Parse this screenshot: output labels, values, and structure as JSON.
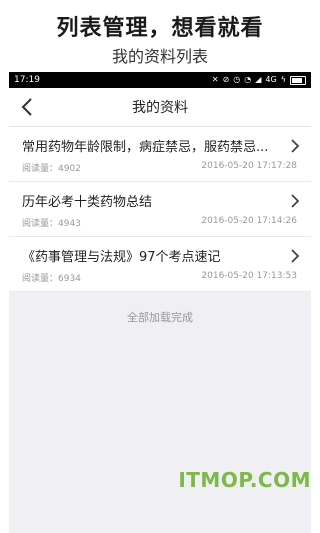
{
  "promo": {
    "title": "列表管理，想看就看",
    "subtitle": "我的资料列表"
  },
  "status_bar": {
    "time": "17:19",
    "network": "4G"
  },
  "nav": {
    "title": "我的资料"
  },
  "items": [
    {
      "title": "常用药物年龄限制，病症禁忌，服药禁忌...",
      "reads": "阅读量：4902",
      "date": "2016-05-20 17:17:28"
    },
    {
      "title": "历年必考十类药物总结",
      "reads": "阅读量：4943",
      "date": "2016-05-20 17:14:26"
    },
    {
      "title": "《药事管理与法规》97个考点速记",
      "reads": "阅读量：6934",
      "date": "2016-05-20 17:13:53"
    }
  ],
  "footer": {
    "loaded_text": "全部加载完成"
  },
  "watermark": "ITMOP.COM",
  "colors": {
    "status_bar_bg": "#000000",
    "page_bg": "#efeff4",
    "watermark": "#7cb947"
  }
}
